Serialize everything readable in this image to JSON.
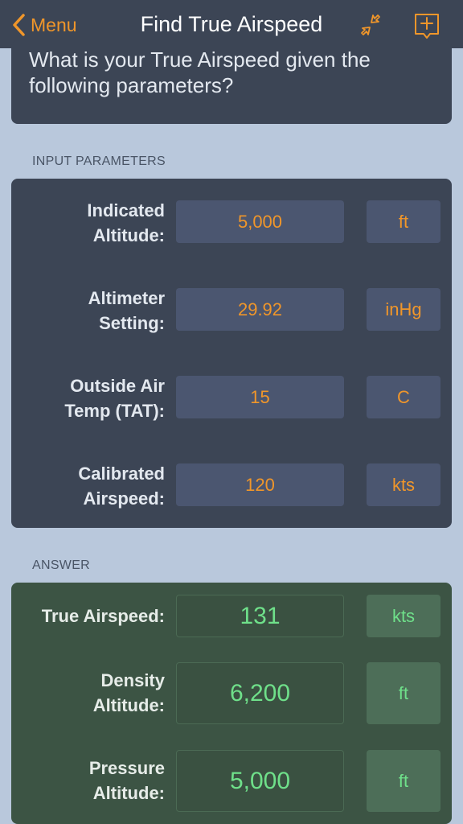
{
  "nav": {
    "back_label": "Menu",
    "title": "Find True Airspeed",
    "icons": [
      "chevron-left-icon",
      "collapse-arrows-icon",
      "bookmark-add-icon"
    ],
    "accent_color": "#f0962a"
  },
  "question": {
    "text": "What is your True Airspeed given the following parameters?"
  },
  "inputs": {
    "header": "INPUT PARAMETERS",
    "rows": [
      {
        "label": "Indicated\nAltitude:",
        "value": "5,000",
        "unit": "ft"
      },
      {
        "label": "Altimeter\nSetting:",
        "value": "29.92",
        "unit": "inHg"
      },
      {
        "label": "Outside Air\nTemp (TAT):",
        "value": "15",
        "unit": "C"
      },
      {
        "label": "Calibrated\nAirspeed:",
        "value": "120",
        "unit": "kts"
      }
    ]
  },
  "answers": {
    "header": "ANSWER",
    "rows": [
      {
        "label": "True Airspeed:",
        "value": "131",
        "unit": "kts"
      },
      {
        "label": "Density\nAltitude:",
        "value": "6,200",
        "unit": "ft"
      },
      {
        "label": "Pressure\nAltitude:",
        "value": "5,000",
        "unit": "ft"
      }
    ]
  }
}
